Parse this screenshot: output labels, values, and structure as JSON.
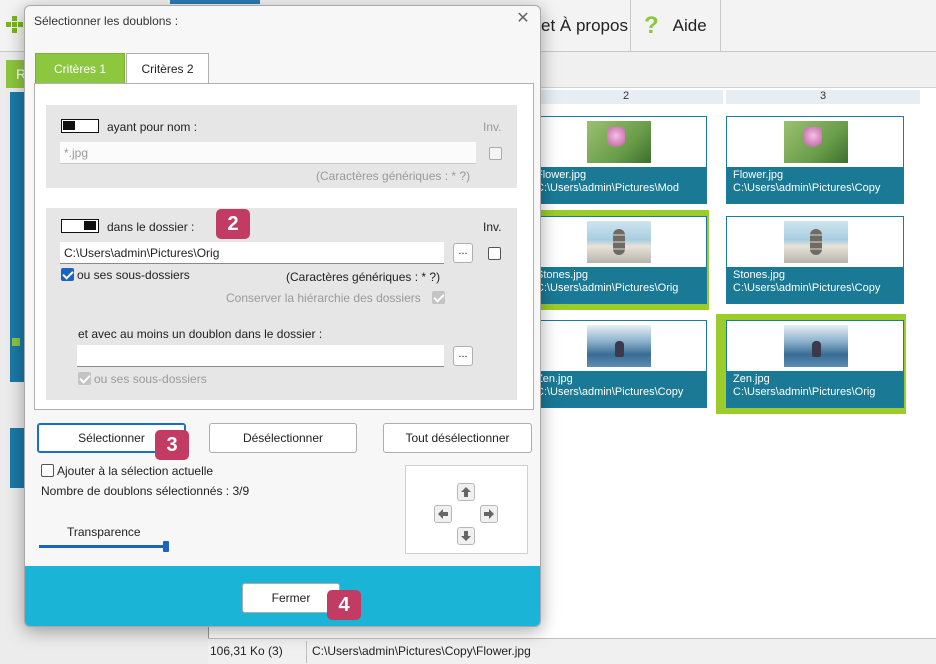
{
  "app": {
    "toolbar": {
      "about_label": "et À propos",
      "help_label": "Aide",
      "left_tab_label": "R"
    },
    "grid": {
      "columns": [
        "2",
        "3"
      ],
      "cards": [
        {
          "name": "Flower.jpg",
          "path": "C:\\Users\\admin\\Pictures\\Mod",
          "thumb": "flower",
          "selected": false
        },
        {
          "name": "Flower.jpg",
          "path": "C:\\Users\\admin\\Pictures\\Copy",
          "thumb": "flower",
          "selected": false
        },
        {
          "name": "Stones.jpg",
          "path": "C:\\Users\\admin\\Pictures\\Orig",
          "thumb": "stones",
          "selected": true
        },
        {
          "name": "Stones.jpg",
          "path": "C:\\Users\\admin\\Pictures\\Copy",
          "thumb": "stones",
          "selected": false
        },
        {
          "name": "Zen.jpg",
          "path": "C:\\Users\\admin\\Pictures\\Copy",
          "thumb": "zen",
          "selected": false
        },
        {
          "name": "Zen.jpg",
          "path": "C:\\Users\\admin\\Pictures\\Orig",
          "thumb": "zen",
          "selected": true
        }
      ]
    },
    "statusbar": {
      "size": "106,31 Ko (3)",
      "path": "C:\\Users\\admin\\Pictures\\Copy\\Flower.jpg"
    }
  },
  "dialog": {
    "title": "Sélectionner les doublons :",
    "close_glyph": "✕",
    "tabs": [
      "Critères 1",
      "Critères 2"
    ],
    "group_name": {
      "label": "ayant pour nom :",
      "inv_label": "Inv.",
      "input_value": "*.jpg",
      "hint": "(Caractères génériques : * ?)"
    },
    "group_folder": {
      "label": "dans le dossier :",
      "inv_label": "Inv.",
      "input_value": "C:\\Users\\admin\\Pictures\\Orig",
      "browse_label": "...",
      "subfolders_label": "ou ses sous-dossiers",
      "hint": "(Caractères génériques : * ?)",
      "keep_hierarchy_label": "Conserver la hiérarchie des dossiers",
      "other_folder_label": "et avec au moins un doublon dans le dossier :",
      "other_input_value": "",
      "other_browse_label": "...",
      "other_subfolders_label": "ou ses sous-dossiers"
    },
    "buttons": {
      "select": "Sélectionner",
      "deselect": "Désélectionner",
      "deselect_all": "Tout désélectionner",
      "close": "Fermer"
    },
    "add_to_selection_label": "Ajouter à la sélection actuelle",
    "count_text": "Nombre de doublons sélectionnés : 3/9",
    "transparency_label": "Transparence",
    "transparency_value": 1.0,
    "badges": [
      "2",
      "3",
      "4"
    ],
    "colors": {
      "accent_green": "#8dc63f",
      "footer_blue": "#1ab4d6",
      "badge": "#c23b63",
      "card_label": "#1a7a96"
    }
  }
}
